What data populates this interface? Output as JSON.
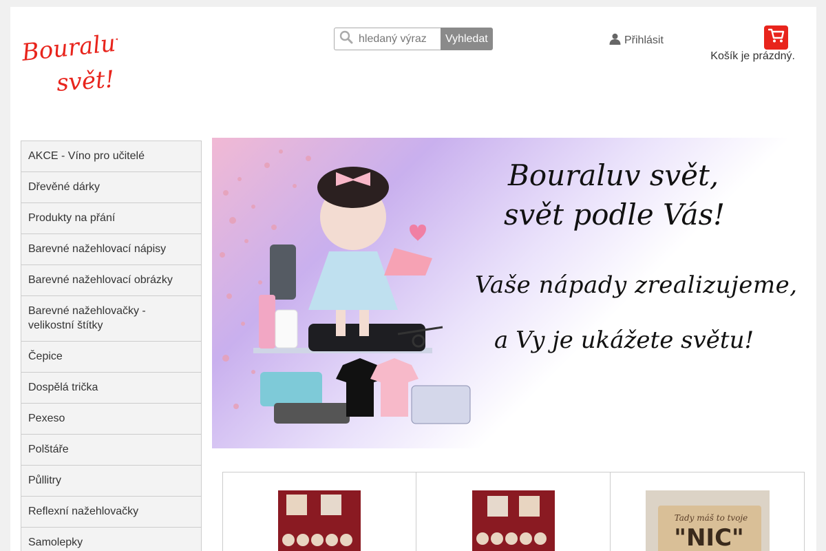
{
  "brand": {
    "logo_text_line1": "Bouraluv",
    "logo_text_line2": "svět!",
    "logo_color": "#e8241c"
  },
  "search": {
    "placeholder": "hledaný výraz",
    "button_label": "Vyhledat"
  },
  "user": {
    "login_label": "Přihlásit"
  },
  "cart": {
    "status_text": "Košík je prázdný.",
    "accent_color": "#e8241c"
  },
  "sidebar": {
    "items": [
      {
        "label": "AKCE - Víno pro učitelé"
      },
      {
        "label": "Dřevěné dárky"
      },
      {
        "label": "Produkty na přání"
      },
      {
        "label": "Barevné nažehlovací nápisy"
      },
      {
        "label": "Barevné nažehlovací obrázky"
      },
      {
        "label": "Barevné nažehlovačky - velikostní štítky"
      },
      {
        "label": "Čepice"
      },
      {
        "label": "Dospělá trička"
      },
      {
        "label": "Pexeso"
      },
      {
        "label": "Polštáře"
      },
      {
        "label": "Půllitry"
      },
      {
        "label": "Reflexní nažehlovačky"
      },
      {
        "label": "Samolepky"
      },
      {
        "label": ""
      }
    ]
  },
  "banner": {
    "line1": "Bouraluv svět,",
    "line2": "svět podle Vás!",
    "line3": "Vaše nápady zrealizujeme,",
    "line4": "a Vy je ukážete světu!"
  },
  "products": [
    {
      "image": "wooden-memory-game-photo"
    },
    {
      "image": "wooden-memory-game-photo"
    },
    {
      "image": "wooden-sign-nic-photo",
      "sign_text_top": "Tady máš to tvoje",
      "sign_text_main": "\"NIC\""
    }
  ]
}
